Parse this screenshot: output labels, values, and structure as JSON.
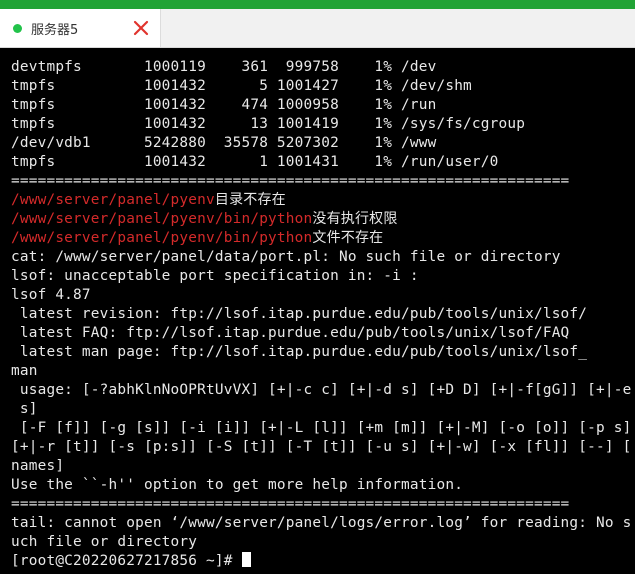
{
  "window": {
    "accent_color": "#21a335",
    "tab": {
      "label": "服务器5",
      "status_color": "#22c34a",
      "close_icon": "close-x-icon"
    }
  },
  "terminal": {
    "background": "#000000",
    "error_color": "#d42a2a",
    "lines": [
      "devtmpfs       1000119    361  999758    1% /dev",
      "tmpfs          1001432      5 1001427    1% /dev/shm",
      "tmpfs          1001432    474 1000958    1% /run",
      "tmpfs          1001432     13 1001419    1% /sys/fs/cgroup",
      "/dev/vdb1      5242880  35578 5207302    1% /www",
      "tmpfs          1001432      1 1001431    1% /run/user/0",
      "===============================================================",
      {
        "path": "/www/server/panel/pyenv",
        "msg": "目录不存在"
      },
      {
        "path": "/www/server/panel/pyenv/bin/python",
        "msg": "没有执行权限"
      },
      {
        "path": "/www/server/panel/pyenv/bin/python",
        "msg": "文件不存在"
      },
      "cat: /www/server/panel/data/port.pl: No such file or directory",
      "lsof: unacceptable port specification in: -i :",
      "lsof 4.87",
      " latest revision: ftp://lsof.itap.purdue.edu/pub/tools/unix/lsof/",
      " latest FAQ: ftp://lsof.itap.purdue.edu/pub/tools/unix/lsof/FAQ",
      " latest man page: ftp://lsof.itap.purdue.edu/pub/tools/unix/lsof_",
      "man",
      " usage: [-?abhKlnNoOPRtUvVX] [+|-c c] [+|-d s] [+D D] [+|-f[gG]] [+|-e",
      " s]",
      " [-F [f]] [-g [s]] [-i [i]] [+|-L [l]] [+m [m]] [+|-M] [-o [o]] [-p s]",
      "[+|-r [t]] [-s [p:s]] [-S [t]] [-T [t]] [-u s] [+|-w] [-x [fl]] [--] [",
      "names]",
      "Use the ``-h'' option to get more help information.",
      "===============================================================",
      "tail: cannot open ‘/www/server/panel/logs/error.log’ for reading: No s",
      "uch file or directory"
    ],
    "prompt": "[root@C20220627217856 ~]# "
  }
}
